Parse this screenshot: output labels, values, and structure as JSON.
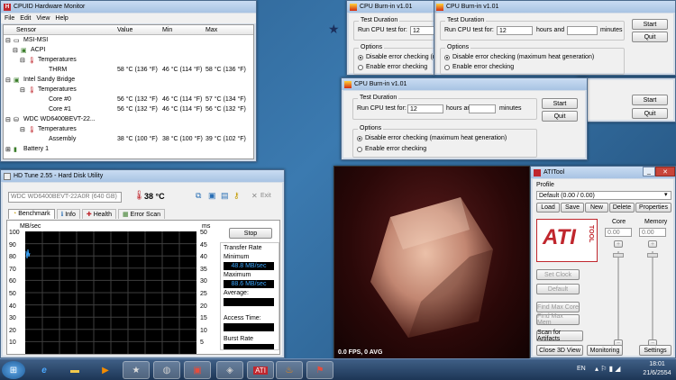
{
  "cpuid": {
    "title": "CPUID Hardware Monitor",
    "menu": [
      "File",
      "Edit",
      "View",
      "Help"
    ],
    "columns": [
      "Sensor",
      "Value",
      "Min",
      "Max"
    ],
    "rows": [
      {
        "label": "MSI-MSI",
        "value": "",
        "min": "",
        "max": ""
      },
      {
        "label": "ACPI",
        "value": "",
        "min": "",
        "max": ""
      },
      {
        "label": "Temperatures",
        "value": "",
        "min": "",
        "max": ""
      },
      {
        "label": "THRM",
        "value": "58 °C  (136 °F)",
        "min": "46 °C  (114 °F)",
        "max": "58 °C  (136 °F)"
      },
      {
        "label": "Intel Sandy Bridge",
        "value": "",
        "min": "",
        "max": ""
      },
      {
        "label": "Temperatures",
        "value": "",
        "min": "",
        "max": ""
      },
      {
        "label": "Core #0",
        "value": "56 °C  (132 °F)",
        "min": "46 °C  (114 °F)",
        "max": "57 °C  (134 °F)"
      },
      {
        "label": "Core #1",
        "value": "56 °C  (132 °F)",
        "min": "46 °C  (114 °F)",
        "max": "56 °C  (132 °F)"
      },
      {
        "label": "WDC WD6400BEVT-22...",
        "value": "",
        "min": "",
        "max": ""
      },
      {
        "label": "Temperatures",
        "value": "",
        "min": "",
        "max": ""
      },
      {
        "label": "Assembly",
        "value": "38 °C  (100 °F)",
        "min": "38 °C  (100 °F)",
        "max": "39 °C  (102 °F)"
      },
      {
        "label": "Battery 1",
        "value": "",
        "min": "",
        "max": ""
      }
    ]
  },
  "burnin": {
    "title": "CPU Burn-in v1.01",
    "test_duration": "Test Duration",
    "run_label": "Run CPU test for:",
    "hours_value": "12",
    "hours_label": "hours and",
    "minutes_label": "minutes",
    "options": "Options",
    "opt_disable": "Disable error checking (maximum heat generation)",
    "opt_enable": "Enable error checking",
    "start": "Start",
    "quit": "Quit"
  },
  "hdtune": {
    "title": "HD Tune 2.55 - Hard Disk Utility",
    "drive": "WDC WD6400BEVT-22A0R (640 GB)",
    "temp": "38 °C",
    "exit": "Exit",
    "tabs": [
      "Benchmark",
      "Info",
      "Health",
      "Error Scan"
    ],
    "y_label": "MB/sec",
    "y2_label": "ms",
    "y_ticks": [
      "100",
      "90",
      "80",
      "70",
      "60",
      "50",
      "40",
      "30",
      "20",
      "10"
    ],
    "y2_ticks": [
      "50",
      "45",
      "40",
      "35",
      "30",
      "25",
      "20",
      "15",
      "10",
      "5"
    ],
    "stop": "Stop",
    "transfer_rate": "Transfer Rate",
    "minimum": "Minimum",
    "min_value": "48.8 MB/sec",
    "maximum": "Maximum",
    "max_value": "88.6 MB/sec",
    "average": "Average:",
    "access_time": "Access Time:",
    "burst_rate": "Burst Rate"
  },
  "render": {
    "fps": "0.0 FPS, 0 AVG"
  },
  "atitool": {
    "title": "ATITool",
    "profile": "Profile",
    "profile_value": "Default (0.00 / 0.00)",
    "buttons": [
      "Load",
      "Save",
      "New",
      "Delete",
      "Properties"
    ],
    "core": "Core",
    "memory": "Memory",
    "core_value": "0.00",
    "memory_value": "0.00",
    "set_clock": "Set Clock",
    "default": "Default",
    "find_max_core": "Find Max Core",
    "find_max_mem": "Find Max Mem",
    "scan_artifacts": "Scan for Artifacts",
    "close_3d": "Close 3D View",
    "monitoring": "Monitoring",
    "settings": "Settings",
    "logo_text": "ATI",
    "logo_sub": "TOOL"
  },
  "taskbar": {
    "lang": "EN",
    "time": "18:01",
    "date": "21/6/2554"
  }
}
